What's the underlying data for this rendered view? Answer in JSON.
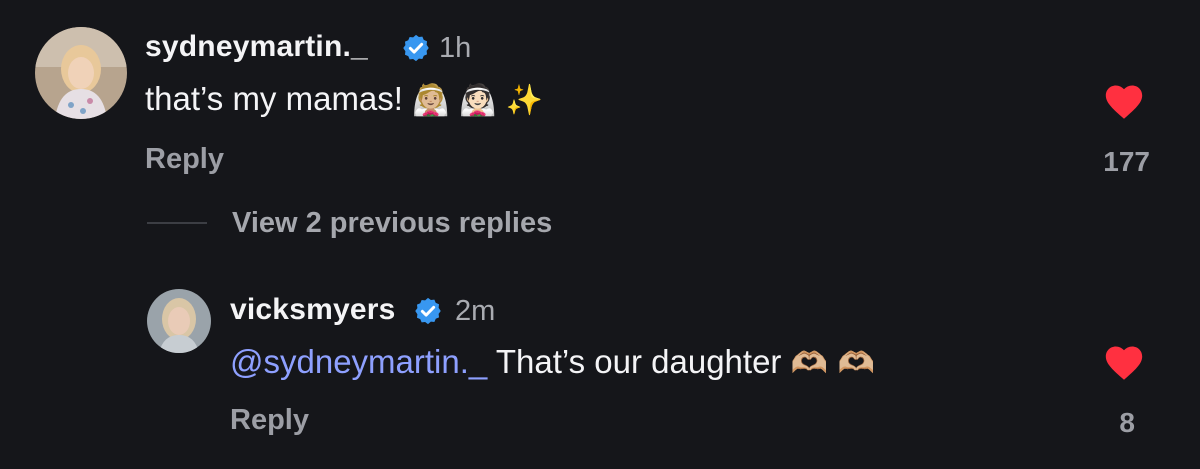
{
  "comment": {
    "username": "sydneymartin._",
    "verified": true,
    "time": "1h",
    "text": "that’s my mamas! ",
    "emojis": "👰🏼 👰🏻 ✨",
    "reply_label": "Reply",
    "likes": "177",
    "liked": true
  },
  "view_replies": {
    "label": "View 2 previous replies"
  },
  "reply": {
    "username": "vicksmyers",
    "verified": true,
    "time": "2m",
    "mention": "@sydneymartin._",
    "text": " That’s our daughter ",
    "emojis": "🫶🏼 🫶🏼",
    "reply_label": "Reply",
    "likes": "8",
    "liked": true
  },
  "colors": {
    "background": "#15161a",
    "heart": "#ff3040",
    "verified": "#3897f0",
    "mention": "#8ea0ff"
  }
}
